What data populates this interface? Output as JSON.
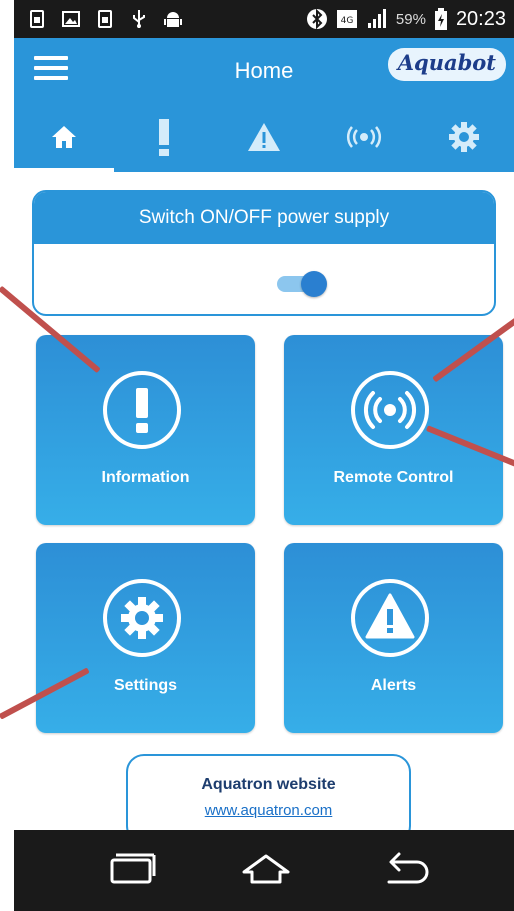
{
  "status_bar": {
    "battery_percent": "59%",
    "time": "20:23"
  },
  "app_bar": {
    "title": "Home",
    "logo_text": "Aquabot"
  },
  "tabs": [
    {
      "name": "home",
      "icon": "home-icon",
      "active": true
    },
    {
      "name": "information",
      "icon": "exclamation-icon",
      "active": false
    },
    {
      "name": "alerts",
      "icon": "warning-icon",
      "active": false
    },
    {
      "name": "remote",
      "icon": "remote-signal-icon",
      "active": false
    },
    {
      "name": "settings",
      "icon": "gear-icon",
      "active": false
    }
  ],
  "power": {
    "label": "Switch ON/OFF power supply",
    "state": "on"
  },
  "tiles": {
    "information": "Information",
    "remote": "Remote Control",
    "settings": "Settings",
    "alerts": "Alerts"
  },
  "website": {
    "title": "Aquatron website",
    "url": "www.aquatron.com"
  },
  "colors": {
    "primary": "#2a95d9",
    "annotation": "#c0504d"
  }
}
